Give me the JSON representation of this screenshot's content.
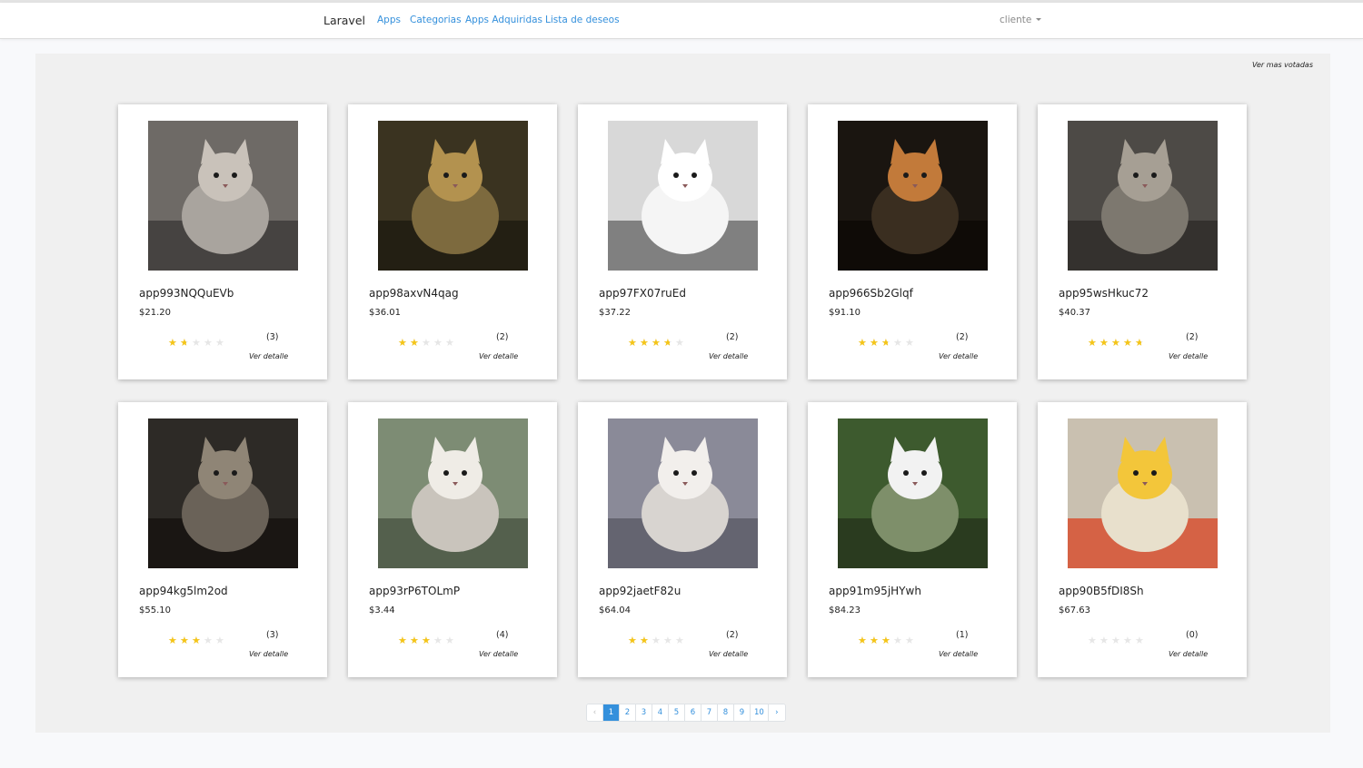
{
  "navbar": {
    "brand": "Laravel",
    "links": [
      "Apps",
      "Categorias",
      "Apps Adquiridas",
      "Lista de deseos"
    ],
    "user": "cliente"
  },
  "top_link": "Ver mas votadas",
  "detail_label": "Ver detalle",
  "colors": {
    "link": "#3490dc",
    "star": "#f5c518",
    "star_empty": "#e6e6e6",
    "panel": "#f0f0f0"
  },
  "cards": [
    {
      "name": "app993NQQuEVb",
      "price": "$21.20",
      "rating": 1.5,
      "count": "(3)"
    },
    {
      "name": "app98axvN4qag",
      "price": "$36.01",
      "rating": 2,
      "count": "(2)"
    },
    {
      "name": "app97FX07ruEd",
      "price": "$37.22",
      "rating": 3.5,
      "count": "(2)"
    },
    {
      "name": "app966Sb2Glqf",
      "price": "$91.10",
      "rating": 2.5,
      "count": "(2)"
    },
    {
      "name": "app95wsHkuc72",
      "price": "$40.37",
      "rating": 4.5,
      "count": "(2)"
    },
    {
      "name": "app94kg5lm2od",
      "price": "$55.10",
      "rating": 3,
      "count": "(3)"
    },
    {
      "name": "app93rP6TOLmP",
      "price": "$3.44",
      "rating": 3,
      "count": "(4)"
    },
    {
      "name": "app92jaetF82u",
      "price": "$64.04",
      "rating": 2,
      "count": "(2)"
    },
    {
      "name": "app91m95jHYwh",
      "price": "$84.23",
      "rating": 3,
      "count": "(1)"
    },
    {
      "name": "app90B5fDI8Sh",
      "price": "$67.63",
      "rating": 0,
      "count": "(0)"
    }
  ],
  "pagination": {
    "prev": "‹",
    "pages": [
      "1",
      "2",
      "3",
      "4",
      "5",
      "6",
      "7",
      "8",
      "9",
      "10"
    ],
    "next": "›",
    "active": "1"
  }
}
